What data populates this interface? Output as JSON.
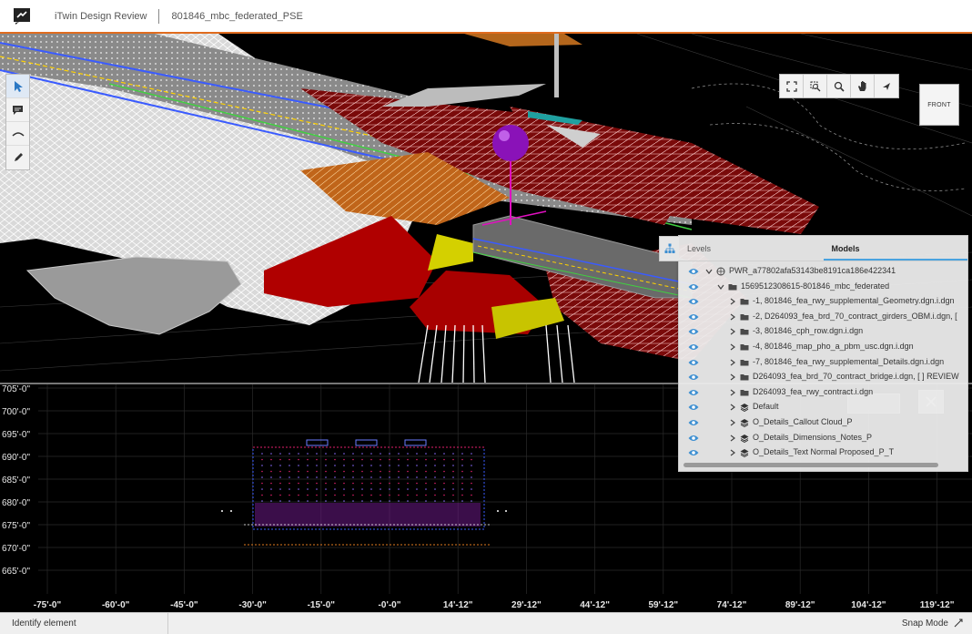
{
  "header": {
    "app_title": "iTwin Design Review",
    "project_name": "801846_mbc_federated_PSE"
  },
  "left_toolbar": {
    "tools": [
      "select-tool",
      "comment-tool",
      "measure-distance-tool",
      "markup-pencil-tool"
    ]
  },
  "nav_toolbar": {
    "tools": [
      "fit-view",
      "window-area-zoom",
      "zoom",
      "pan",
      "rotate-walk"
    ]
  },
  "view_cube": {
    "face_label": "FRONT"
  },
  "section_view": {
    "y_ticks": [
      "705'-0\"",
      "700'-0\"",
      "695'-0\"",
      "690'-0\"",
      "685'-0\"",
      "680'-0\"",
      "675'-0\"",
      "670'-0\"",
      "665'-0\""
    ],
    "x_ticks": [
      "-75'-0\"",
      "-60'-0\"",
      "-45'-0\"",
      "-30'-0\"",
      "-15'-0\"",
      "-0'-0\"",
      "14'-12\"",
      "29'-12\"",
      "44'-12\"",
      "59'-12\"",
      "74'-12\"",
      "89'-12\"",
      "104'-12\"",
      "119'-12\""
    ]
  },
  "models_panel": {
    "tabs": [
      {
        "label": "Levels",
        "active": false
      },
      {
        "label": "Models",
        "active": true
      }
    ],
    "tree": [
      {
        "label": "PWR_a77802afa53143be8191ca186e422341",
        "depth": 0,
        "expanded": true,
        "icon": "globe-icon"
      },
      {
        "label": "1569512308615-801846_mbc_federated",
        "depth": 1,
        "expanded": true,
        "icon": "folder-icon"
      },
      {
        "label": "-1, 801846_fea_rwy_supplemental_Geometry.dgn.i.dgn",
        "depth": 2,
        "expanded": false,
        "icon": "folder-icon"
      },
      {
        "label": "-2, D264093_fea_brd_70_contract_girders_OBM.i.dgn, [",
        "depth": 2,
        "expanded": false,
        "icon": "folder-icon"
      },
      {
        "label": "-3, 801846_cph_row.dgn.i.dgn",
        "depth": 2,
        "expanded": false,
        "icon": "folder-icon"
      },
      {
        "label": "-4, 801846_map_pho_a_pbm_usc.dgn.i.dgn",
        "depth": 2,
        "expanded": false,
        "icon": "folder-icon"
      },
      {
        "label": "-7, 801846_fea_rwy_supplemental_Details.dgn.i.dgn",
        "depth": 2,
        "expanded": false,
        "icon": "folder-icon"
      },
      {
        "label": "D264093_fea_brd_70_contract_bridge.i.dgn, [ ] REVIEW",
        "depth": 2,
        "expanded": false,
        "icon": "folder-icon"
      },
      {
        "label": "D264093_fea_rwy_contract.i.dgn",
        "depth": 2,
        "expanded": false,
        "icon": "folder-icon"
      },
      {
        "label": "Default",
        "depth": 2,
        "expanded": false,
        "icon": "layers-icon"
      },
      {
        "label": "O_Details_Callout Cloud_P",
        "depth": 2,
        "expanded": false,
        "icon": "layers-icon"
      },
      {
        "label": "O_Details_Dimensions_Notes_P",
        "depth": 2,
        "expanded": false,
        "icon": "layers-icon"
      },
      {
        "label": "O_Details_Text Normal Proposed_P_T",
        "depth": 2,
        "expanded": false,
        "icon": "layers-icon"
      }
    ]
  },
  "statusbar": {
    "prompt": "Identify element",
    "snap_mode": "Snap Mode"
  },
  "colors": {
    "accent_orange": "#e06c1f",
    "eye_blue": "#3d8fd1",
    "tab_underline": "#4aa3df"
  }
}
